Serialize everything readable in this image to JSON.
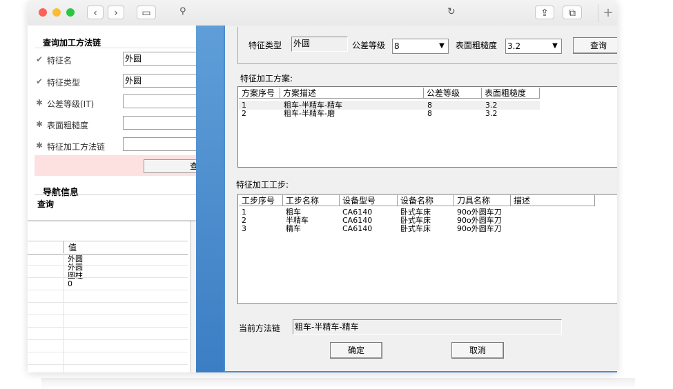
{
  "window": {
    "traffic_lights": [
      "#ff5f57",
      "#febc2e",
      "#28c840"
    ],
    "nav": {
      "back_icon": "‹",
      "forward_icon": "›",
      "sidebar_icon": "▭",
      "search_icon": "⚲",
      "reload_icon": "↻",
      "share_icon": "⇪",
      "tabs_icon": "⧉",
      "new_tab_icon": "+"
    }
  },
  "query_panel": {
    "title": "查询加工方法链",
    "fields": [
      {
        "label": "特征名",
        "value": "外圆",
        "mark": "✔"
      },
      {
        "label": "特征类型",
        "value": "外圆",
        "mark": "✔"
      },
      {
        "label": "公差等级(IT)",
        "value": "",
        "mark": "✱"
      },
      {
        "label": "表面粗糙度",
        "value": "",
        "mark": "✱"
      },
      {
        "label": "特征加工方法链",
        "value": "",
        "mark": "✱"
      }
    ],
    "query_button": "查",
    "nav_title": "导航信息",
    "nav_item": "查询"
  },
  "value_table": {
    "header": "值",
    "rows": [
      "外圆",
      "外圆",
      "圆柱",
      "0"
    ]
  },
  "dialog": {
    "filter": {
      "feature_type_label": "特征类型",
      "feature_type_value": "外圆",
      "tolerance_label": "公差等级",
      "tolerance_value": "8",
      "roughness_label": "表面粗糙度",
      "roughness_value": "3.2",
      "query_button": "查询"
    },
    "plans": {
      "title": "特征加工方案:",
      "columns": [
        "方案序号",
        "方案描述",
        "公差等级",
        "表面粗糙度"
      ],
      "rows": [
        [
          "1",
          "粗车-半精车-精车",
          "8",
          "3.2"
        ],
        [
          "2",
          "粗车-半精车-磨",
          "8",
          "3.2"
        ]
      ]
    },
    "steps": {
      "title": "特征加工工步:",
      "columns": [
        "工步序号",
        "工步名称",
        "设备型号",
        "设备名称",
        "刀具名称",
        "描述"
      ],
      "rows": [
        [
          "1",
          "粗车",
          "CA6140",
          "卧式车床",
          "90o外圆车刀",
          ""
        ],
        [
          "2",
          "半精车",
          "CA6140",
          "卧式车床",
          "90o外圆车刀",
          ""
        ],
        [
          "3",
          "精车",
          "CA6140",
          "卧式车床",
          "90o外圆车刀",
          ""
        ]
      ]
    },
    "current_chain_label": "当前方法链",
    "current_chain_value": "粗车-半精车-精车",
    "ok_button": "确定",
    "cancel_button": "取消"
  }
}
